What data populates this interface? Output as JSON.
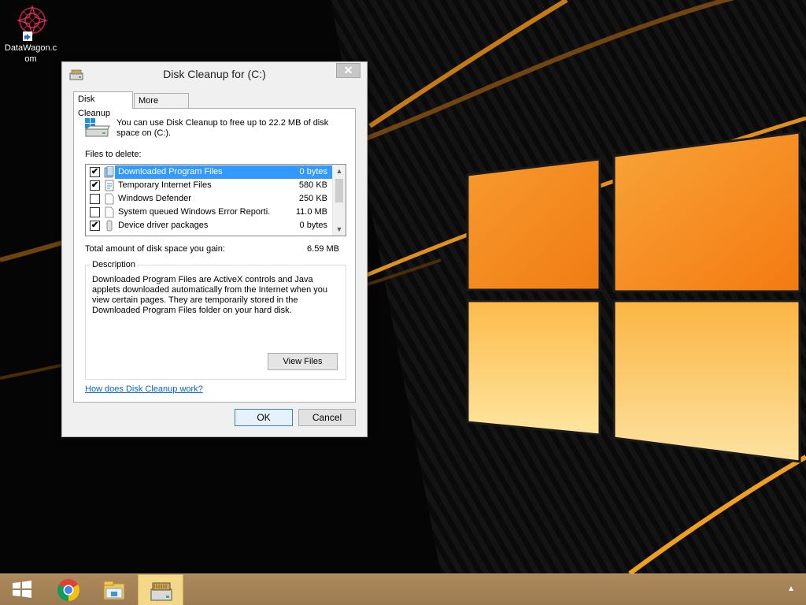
{
  "desktop": {
    "icon_label": "DataWagon.com"
  },
  "dialog": {
    "title": "Disk Cleanup for  (C:)",
    "close_glyph": "✕",
    "tabs": [
      {
        "label": "Disk Cleanup",
        "active": true
      },
      {
        "label": "More Options",
        "active": false
      }
    ],
    "intro_text": "You can use Disk Cleanup to free up to 22.2 MB of disk space on  (C:).",
    "files_label": "Files to delete:",
    "files": [
      {
        "name": "Downloaded Program Files",
        "size": "0 bytes",
        "checked": true,
        "selected": true
      },
      {
        "name": "Temporary Internet Files",
        "size": "580 KB",
        "checked": true,
        "selected": false
      },
      {
        "name": "Windows Defender",
        "size": "250 KB",
        "checked": false,
        "selected": false
      },
      {
        "name": "System queued Windows Error Reporti...",
        "size": "11.0 MB",
        "checked": false,
        "selected": false
      },
      {
        "name": "Device driver packages",
        "size": "0 bytes",
        "checked": true,
        "selected": false
      }
    ],
    "total_label": "Total amount of disk space you gain:",
    "total_value": "6.59 MB",
    "description_legend": "Description",
    "description_text": "Downloaded Program Files are ActiveX controls and Java applets downloaded automatically from the Internet when you view certain pages. They are temporarily stored in the Downloaded Program Files folder on your hard disk.",
    "view_files_label": "View Files",
    "help_link": "How does Disk Cleanup work?",
    "ok_label": "OK",
    "cancel_label": "Cancel"
  },
  "taskbar": {
    "items": [
      {
        "name": "start",
        "icon": "windows-logo-icon",
        "active": false
      },
      {
        "name": "chrome",
        "icon": "chrome-icon",
        "active": false
      },
      {
        "name": "file-explorer",
        "icon": "file-explorer-icon",
        "active": false
      },
      {
        "name": "disk-cleanup",
        "icon": "disk-cleanup-icon",
        "active": true
      }
    ],
    "tray_glyph": "▲"
  },
  "colors": {
    "selection": "#3399ff",
    "link": "#0066cc",
    "taskbar": "#a98658",
    "wallpaper_orange": "#f7941d"
  }
}
